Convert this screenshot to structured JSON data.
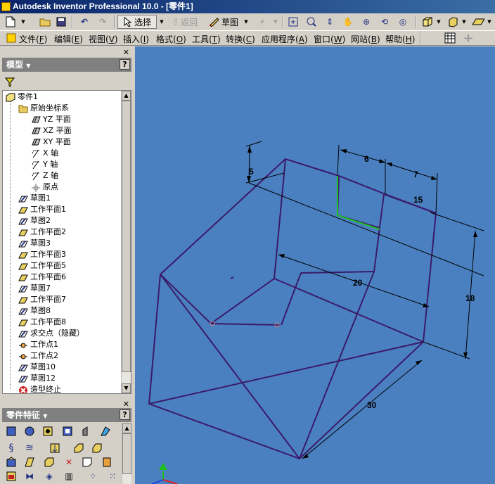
{
  "window": {
    "title": "Autodesk Inventor Professional 10.0 - [零件1]"
  },
  "toolbar": {
    "select_label": "选择",
    "return_label": "返回",
    "sketch_label": "草图"
  },
  "menu": [
    {
      "label": "文件",
      "key": "F"
    },
    {
      "label": "编辑",
      "key": "E"
    },
    {
      "label": "视图",
      "key": "V"
    },
    {
      "label": "插入",
      "key": "I"
    },
    {
      "label": "格式",
      "key": "O"
    },
    {
      "label": "工具",
      "key": "T"
    },
    {
      "label": "转换",
      "key": "C"
    },
    {
      "label": "应用程序",
      "key": "A"
    },
    {
      "label": "窗口",
      "key": "W"
    },
    {
      "label": "网站",
      "key": "B"
    },
    {
      "label": "帮助",
      "key": "H"
    }
  ],
  "model_panel": {
    "title": "模型",
    "help": "?",
    "tree": [
      {
        "label": "零件1",
        "icon": "part-icon",
        "level": 0
      },
      {
        "label": "原始坐标系",
        "icon": "folder-icon",
        "level": 1
      },
      {
        "label": "YZ 平面",
        "icon": "plane-icon",
        "level": 2
      },
      {
        "label": "XZ 平面",
        "icon": "plane-icon",
        "level": 2
      },
      {
        "label": "XY 平面",
        "icon": "plane-icon",
        "level": 2
      },
      {
        "label": "X 轴",
        "icon": "axis-icon",
        "level": 2
      },
      {
        "label": "Y 轴",
        "icon": "axis-icon",
        "level": 2
      },
      {
        "label": "Z 轴",
        "icon": "axis-icon",
        "level": 2
      },
      {
        "label": "原点",
        "icon": "origin-point-icon",
        "level": 2
      },
      {
        "label": "草图1",
        "icon": "sketch-icon",
        "level": 1
      },
      {
        "label": "工作平面1",
        "icon": "work-plane-icon",
        "level": 1
      },
      {
        "label": "草图2",
        "icon": "sketch-icon",
        "level": 1
      },
      {
        "label": "工作平面2",
        "icon": "work-plane-icon",
        "level": 1
      },
      {
        "label": "草图3",
        "icon": "sketch-icon",
        "level": 1
      },
      {
        "label": "工作平面3",
        "icon": "work-plane-icon",
        "level": 1
      },
      {
        "label": "工作平面5",
        "icon": "work-plane-icon",
        "level": 1
      },
      {
        "label": "工作平面6",
        "icon": "work-plane-icon",
        "level": 1
      },
      {
        "label": "草图7",
        "icon": "sketch-icon",
        "level": 1
      },
      {
        "label": "工作平面7",
        "icon": "work-plane-icon",
        "level": 1
      },
      {
        "label": "草图8",
        "icon": "sketch-icon",
        "level": 1
      },
      {
        "label": "工作平面8",
        "icon": "work-plane-icon",
        "level": 1
      },
      {
        "label": "求交点（隐藏）",
        "icon": "sketch-icon",
        "level": 1
      },
      {
        "label": "工作点1",
        "icon": "work-point-icon",
        "level": 1
      },
      {
        "label": "工作点2",
        "icon": "work-point-icon",
        "level": 1
      },
      {
        "label": "草图10",
        "icon": "sketch-icon",
        "level": 1
      },
      {
        "label": "草图12",
        "icon": "sketch-icon",
        "level": 1
      },
      {
        "label": "造型终止",
        "icon": "end-of-part-icon",
        "level": 1
      }
    ]
  },
  "features_panel": {
    "title": "零件特征",
    "help": "?"
  },
  "dimensions": [
    "5",
    "6",
    "7",
    "15",
    "20",
    "18",
    "30"
  ],
  "colors": {
    "canvas_bg": "#4a80c0",
    "edge": "#3a1a6a",
    "title_bar_start": "#0a246a",
    "title_bar_end": "#3a6ea5"
  }
}
